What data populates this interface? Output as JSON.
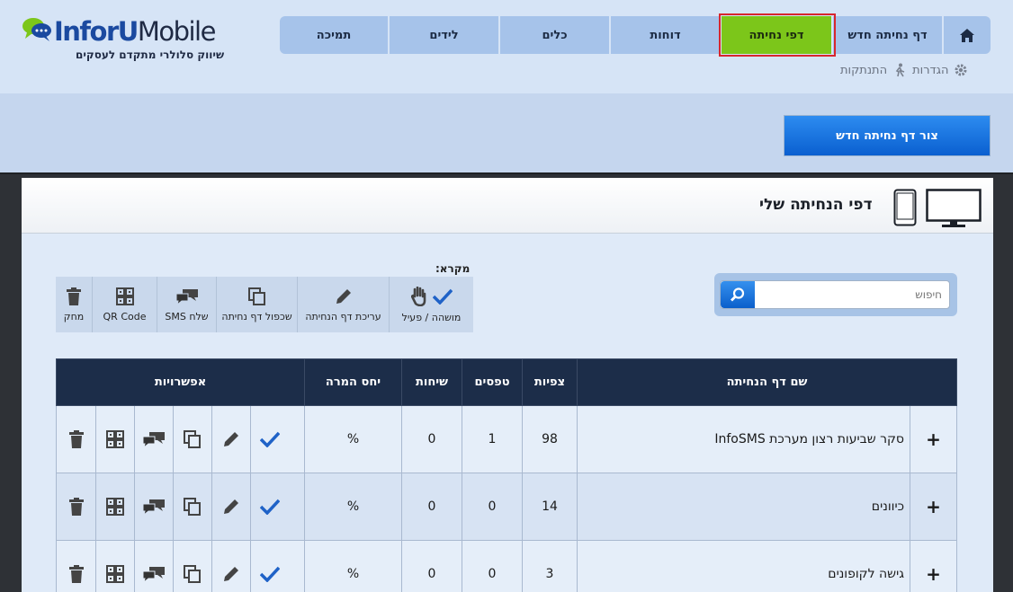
{
  "logo": {
    "brand_a": "InforU",
    "brand_b": "Mobile",
    "tagline": "שיווק סלולרי מתקדם לעסקים"
  },
  "nav": {
    "items": [
      {
        "label": "תמיכה"
      },
      {
        "label": "לידים"
      },
      {
        "label": "כלים"
      },
      {
        "label": "דוחות"
      },
      {
        "label": "דפי נחיתה"
      },
      {
        "label": "דף נחיתה חדש"
      }
    ],
    "home_icon": "home-icon"
  },
  "sub_links": {
    "settings": "הגדרות",
    "logout": "התנתקות"
  },
  "actions": {
    "create_label": "צור דף נחיתה חדש"
  },
  "panel": {
    "title": "דפי הנחיתה שלי"
  },
  "search": {
    "placeholder": "חיפוש"
  },
  "legend": {
    "label": "מקרא:",
    "items": [
      {
        "label": "מושהה / פעיל",
        "icon": "hand-check-icon"
      },
      {
        "label": "עריכת דף הנחיתה",
        "icon": "pencil-icon"
      },
      {
        "label": "שכפול דף נחיתה",
        "icon": "copy-icon"
      },
      {
        "label": "שלח SMS",
        "icon": "chat-icon"
      },
      {
        "label": "QR Code",
        "icon": "qr-icon"
      },
      {
        "label": "מחק",
        "icon": "trash-icon"
      }
    ]
  },
  "table": {
    "headers": {
      "name": "שם דף הנחיתה",
      "views": "צפיות",
      "forms": "טפסים",
      "calls": "שיחות",
      "conversion": "יחס המרה",
      "options": "אפשרויות"
    },
    "rows": [
      {
        "expand": "+",
        "name": "סקר שביעות רצון מערכת InfoSMS",
        "views": "98",
        "forms": "1",
        "calls": "0",
        "conversion": "%"
      },
      {
        "expand": "+",
        "name": "כיוונים",
        "views": "14",
        "forms": "0",
        "calls": "0",
        "conversion": "%"
      },
      {
        "expand": "+",
        "name": "גישה לקופונים",
        "views": "3",
        "forms": "0",
        "calls": "0",
        "conversion": "%"
      }
    ]
  },
  "colors": {
    "active_nav": "#7cc61a",
    "nav": "#a6c3ea",
    "table_header": "#1c2d49",
    "primary_button": "#1572e0"
  }
}
